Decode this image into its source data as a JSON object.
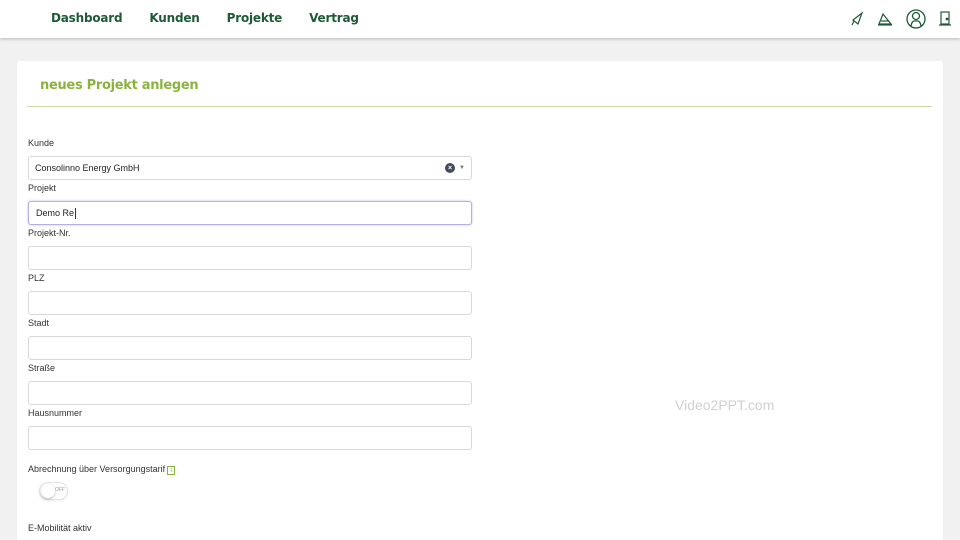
{
  "nav": {
    "dashboard": "Dashboard",
    "kunden": "Kunden",
    "projekte": "Projekte",
    "vertrag": "Vertrag"
  },
  "header_icons": [
    "megaphone-icon",
    "announcement-icon",
    "user-account-icon",
    "logout-icon"
  ],
  "colors": {
    "nav_text": "#1f5a36",
    "title_green": "#8bb43e",
    "focus_border": "#b9aee0"
  },
  "form": {
    "title": "neues Projekt anlegen",
    "kunde": {
      "label": "Kunde",
      "value": "Consolinno Energy GmbH",
      "clear": "×",
      "arrow": "▼"
    },
    "projekt": {
      "label": "Projekt",
      "value": "Demo Re"
    },
    "projekt_nr": {
      "label": "Projekt-Nr.",
      "value": ""
    },
    "plz": {
      "label": "PLZ",
      "value": ""
    },
    "stadt": {
      "label": "Stadt",
      "value": ""
    },
    "strasse": {
      "label": "Straße",
      "value": ""
    },
    "hausnummer": {
      "label": "Hausnummer",
      "value": ""
    },
    "abrechnung": {
      "label": "Abrechnung über Versorgungstarif",
      "info": "i",
      "toggle_text": "OFF"
    },
    "emobilitaet": {
      "label": "E-Mobilität aktiv"
    }
  },
  "watermark": "Video2PPT.com"
}
